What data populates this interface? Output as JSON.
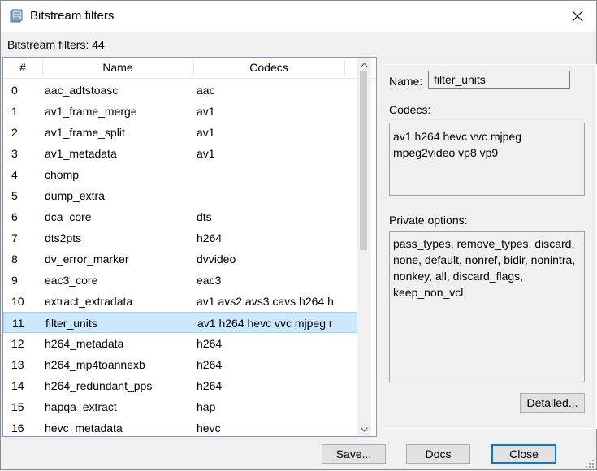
{
  "window": {
    "title": "Bitstream filters",
    "count_label": "Bitstream filters: 44"
  },
  "list": {
    "columns": [
      "#",
      "Name",
      "Codecs"
    ],
    "selected_index": 11,
    "rows": [
      {
        "num": "0",
        "name": "aac_adtstoasc",
        "codecs": "aac"
      },
      {
        "num": "1",
        "name": "av1_frame_merge",
        "codecs": "av1"
      },
      {
        "num": "2",
        "name": "av1_frame_split",
        "codecs": "av1"
      },
      {
        "num": "3",
        "name": "av1_metadata",
        "codecs": "av1"
      },
      {
        "num": "4",
        "name": "chomp",
        "codecs": ""
      },
      {
        "num": "5",
        "name": "dump_extra",
        "codecs": ""
      },
      {
        "num": "6",
        "name": "dca_core",
        "codecs": "dts"
      },
      {
        "num": "7",
        "name": "dts2pts",
        "codecs": "h264"
      },
      {
        "num": "8",
        "name": "dv_error_marker",
        "codecs": "dvvideo"
      },
      {
        "num": "9",
        "name": "eac3_core",
        "codecs": "eac3"
      },
      {
        "num": "10",
        "name": "extract_extradata",
        "codecs": "av1 avs2 avs3 cavs h264 h"
      },
      {
        "num": "11",
        "name": "filter_units",
        "codecs": "av1 h264 hevc vvc mjpeg r"
      },
      {
        "num": "12",
        "name": "h264_metadata",
        "codecs": "h264"
      },
      {
        "num": "13",
        "name": "h264_mp4toannexb",
        "codecs": "h264"
      },
      {
        "num": "14",
        "name": "h264_redundant_pps",
        "codecs": "h264"
      },
      {
        "num": "15",
        "name": "hapqa_extract",
        "codecs": "hap"
      },
      {
        "num": "16",
        "name": "hevc_metadata",
        "codecs": "hevc"
      }
    ]
  },
  "details": {
    "name_label": "Name:",
    "name_value": "filter_units",
    "codecs_label": "Codecs:",
    "codecs_value": "av1 h264 hevc vvc mjpeg\nmpeg2video vp8 vp9",
    "private_label": "Private options:",
    "private_value": "pass_types, remove_types, discard, none, default, nonref, bidir, nonintra, nonkey, all, discard_flags, keep_non_vcl",
    "detailed_button": "Detailed..."
  },
  "buttons": {
    "save": "Save...",
    "docs": "Docs",
    "close": "Close"
  },
  "colors": {
    "selection_bg": "#cce8ff",
    "selection_border": "#99d1ff",
    "default_button_border": "#0078d7"
  }
}
